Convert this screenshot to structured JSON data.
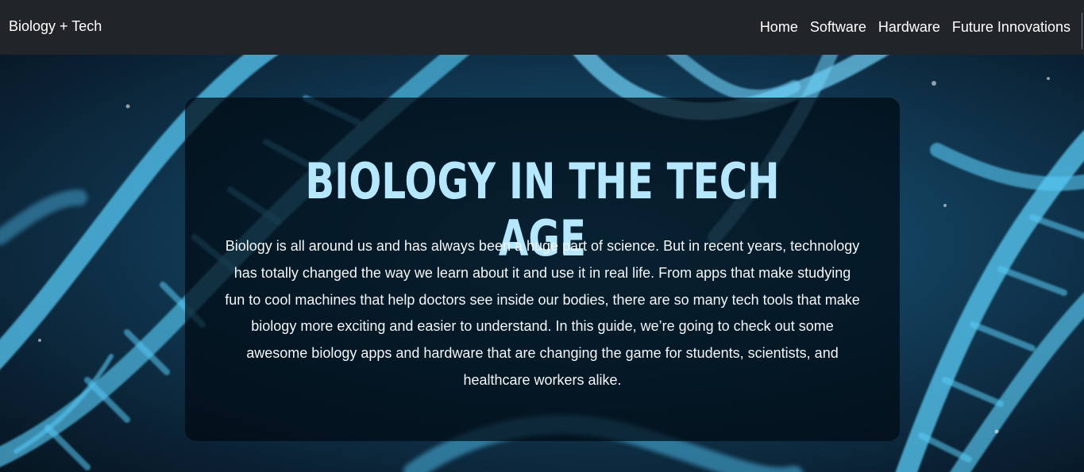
{
  "navbar": {
    "brand": "Biology + Tech",
    "links": [
      {
        "label": "Home"
      },
      {
        "label": "Software"
      },
      {
        "label": "Hardware"
      },
      {
        "label": "Future Innovations"
      }
    ]
  },
  "hero": {
    "title": "Biology in the Tech Age",
    "text": "Biology is all around us and has always been a huge part of science. But in recent years, technology has totally changed the way we learn about it and use it in real life. From apps that make studying fun to cool machines that help doctors see inside our bodies, there are so many tech tools that make biology more exciting and easier to understand. In this guide, we’re going to check out some awesome biology apps and hardware that are changing the game for students, scientists, and healthcare workers alike."
  },
  "colors": {
    "navbar_bg": "#212529",
    "title_color": "#b5e8ff",
    "card_bg": "rgba(0,10,18,0.72)",
    "dna_color": "#4fc3f7"
  },
  "background_image": "dna-double-helix"
}
